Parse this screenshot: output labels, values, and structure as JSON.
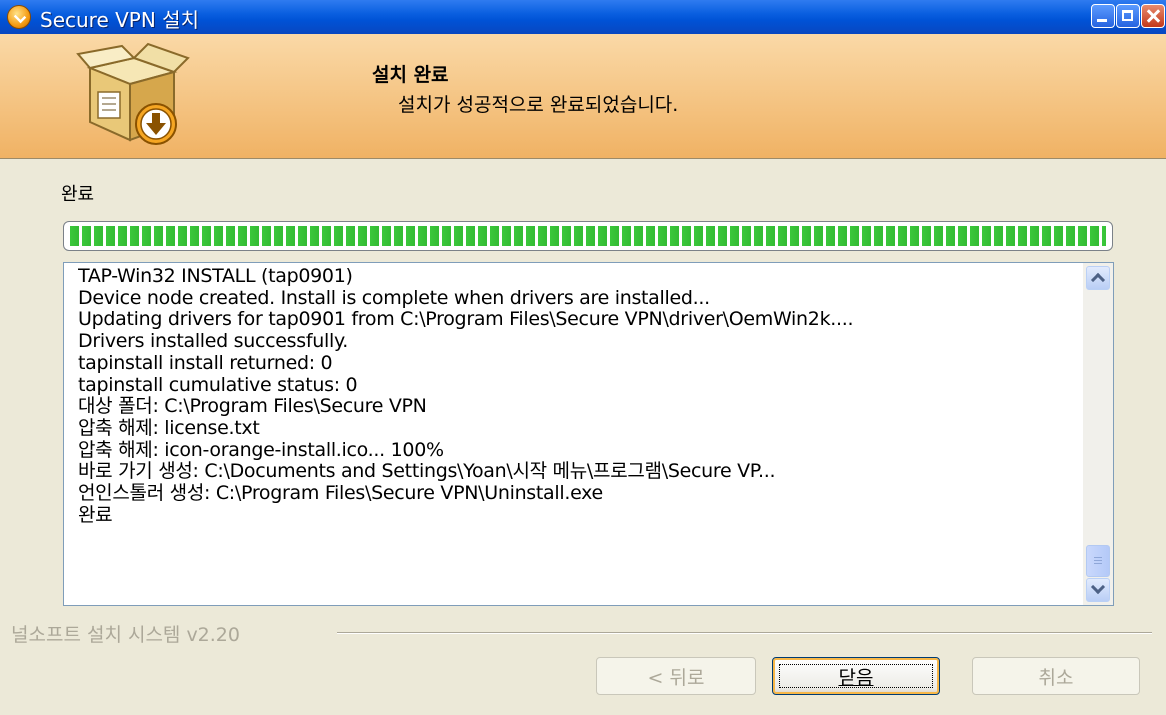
{
  "window": {
    "title": "Secure VPN 설치",
    "icon": "installer-icon",
    "controls": [
      "minimize-icon",
      "maximize-icon",
      "close-icon"
    ]
  },
  "header": {
    "title": "설치 완료",
    "subtitle": "설치가 성공적으로 완료되었습니다.",
    "icon": "box-download-icon"
  },
  "status": {
    "label": "완료",
    "progress": 1.0
  },
  "log": {
    "lines": [
      "TAP-Win32 INSTALL (tap0901)",
      "Device node created. Install is complete when drivers are installed...",
      "Updating drivers for tap0901 from C:\\Program Files\\Secure VPN\\driver\\OemWin2k....",
      "Drivers installed successfully.",
      "tapinstall install returned: 0",
      "tapinstall cumulative status: 0",
      "대상 폴더: C:\\Program Files\\Secure VPN",
      "압축 해제: license.txt",
      "압축 해제: icon-orange-install.ico... 100%",
      "바로 가기 생성: C:\\Documents and Settings\\Yoan\\시작 메뉴\\프로그램\\Secure VP...",
      "언인스톨러 생성: C:\\Program Files\\Secure VPN\\Uninstall.exe",
      "완료"
    ]
  },
  "footer": {
    "branding": "널소프트 설치 시스템 v2.20"
  },
  "buttons": {
    "back": "< 뒤로",
    "close": "닫음",
    "cancel": "취소"
  },
  "colors": {
    "titlebar": "#0A5FE0",
    "header_bg": "#F4C47E",
    "progress_green": "#33BB33",
    "dialog_bg": "#ECE9D8"
  }
}
